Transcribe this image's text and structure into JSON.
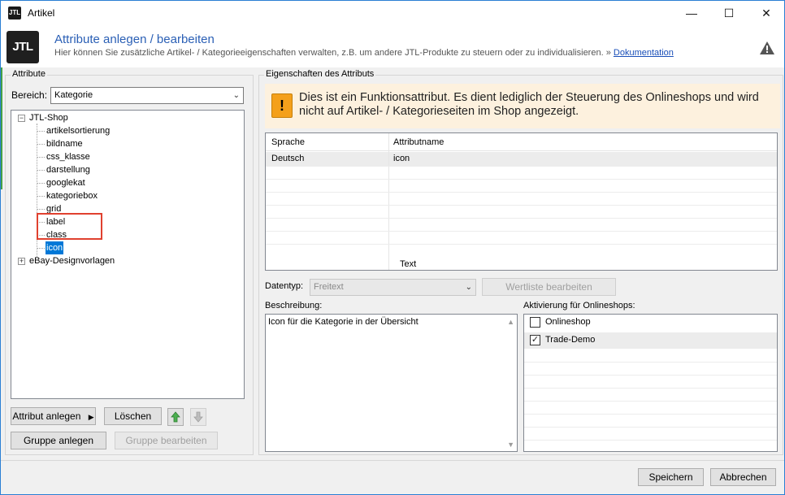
{
  "window": {
    "title": "Artikel",
    "app_icon": "JTL",
    "minimize_icon": "—",
    "maximize_icon": "☐",
    "close_icon": "✕"
  },
  "header": {
    "logo": "JTL",
    "title": "Attribute anlegen / bearbeiten",
    "subtitle": "Hier können Sie zusätzliche Artikel- / Kategorieeigenschaften verwalten, z.B. um andere JTL-Produkte zu steuern oder zu individualisieren.",
    "link_prefix": "»",
    "link_label": "Dokumentation"
  },
  "attribute_panel": {
    "group_label": "Attribute",
    "bereich_label": "Bereich:",
    "bereich_value": "Kategorie",
    "tree": {
      "root": "JTL-Shop",
      "children": [
        "artikelsortierung",
        "bildname",
        "css_klasse",
        "darstellung",
        "googlekat",
        "kategoriebox",
        "grid",
        "label",
        "class",
        "icon"
      ],
      "selected": "icon",
      "second_root": "eBay-Designvorlagen"
    },
    "buttons": {
      "attribut_anlegen": "Attribut anlegen",
      "loeschen": "Löschen",
      "gruppe_anlegen": "Gruppe anlegen",
      "gruppe_bearbeiten": "Gruppe bearbeiten"
    }
  },
  "properties_panel": {
    "group_label": "Eigenschaften des Attributs",
    "notice": "Dies ist ein Funktionsattribut. Es dient lediglich der Steuerung des Onlineshops und wird nicht auf Artikel- / Kategorieseiten im Shop angezeigt.",
    "grid": {
      "columns": [
        "Sprache",
        "Attributname"
      ],
      "rows": [
        {
          "sprache": "Deutsch",
          "attributname": "icon"
        }
      ],
      "footer_text": "Text"
    },
    "datentyp_label": "Datentyp:",
    "datentyp_value": "Freitext",
    "wertliste_button": "Wertliste bearbeiten",
    "beschreibung_label": "Beschreibung:",
    "beschreibung_value": "Icon für die Kategorie in der Übersicht",
    "aktivierung_label": "Aktivierung für Onlineshops:",
    "shops": [
      {
        "name": "Onlineshop",
        "checked": false
      },
      {
        "name": "Trade-Demo",
        "checked": true
      }
    ]
  },
  "footer": {
    "save": "Speichern",
    "cancel": "Abbrechen"
  },
  "colors": {
    "accent": "#2a5fb5",
    "selection": "#0078d7",
    "highlight_box": "#e0412f",
    "notice_bg": "#fdf1de",
    "warning": "#f4a01b"
  }
}
